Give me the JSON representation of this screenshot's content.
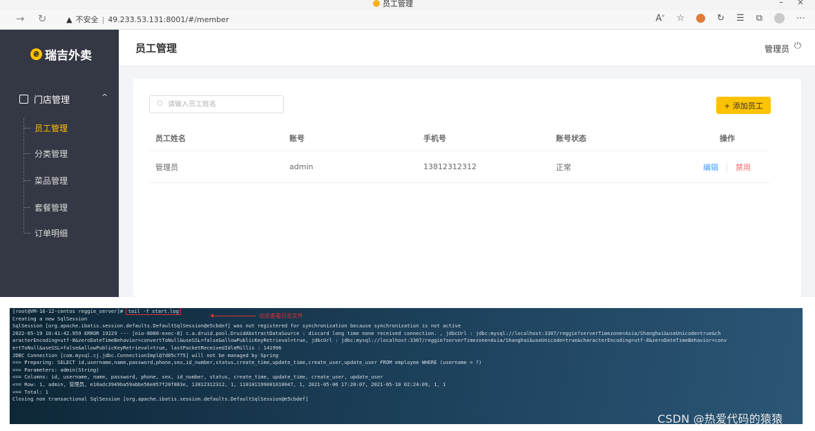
{
  "browser": {
    "tab_title": "员工管理",
    "security_label": "不安全",
    "url": "49.233.53.131:8001/#/member"
  },
  "app": {
    "logo_text": "瑞吉外卖",
    "page_title": "员工管理",
    "user_name": "管理员",
    "sidebar": {
      "group_label": "门店管理",
      "items": [
        {
          "label": "员工管理",
          "active": true
        },
        {
          "label": "分类管理",
          "active": false
        },
        {
          "label": "菜品管理",
          "active": false
        },
        {
          "label": "套餐管理",
          "active": false
        },
        {
          "label": "订单明细",
          "active": false
        }
      ]
    },
    "search": {
      "placeholder": "请输入员工姓名",
      "value": ""
    },
    "add_button_label": "+ 添加员工",
    "table": {
      "headers": [
        "员工姓名",
        "账号",
        "手机号",
        "账号状态",
        "操作"
      ],
      "rows": [
        {
          "name": "管理员",
          "account": "admin",
          "phone": "13812312312",
          "status": "正常",
          "edit": "编辑",
          "disable": "禁用"
        }
      ]
    },
    "colors": {
      "sidebar_bg": "#343744",
      "accent": "#ffc200",
      "edit": "#419eff",
      "disable": "#f56c6c"
    }
  },
  "terminal": {
    "prompt": "[root@VM-16-12-centos reggie_server]#",
    "command": "tail -f start.log",
    "annotation": "动态查看日志文件",
    "lines": [
      "Creating a new SqlSession",
      "SqlSession [org.apache.ibatis.session.defaults.DefaultSqlSession@e5cbdef] was not registered for synchronization because synchronization is not active",
      "2022-05-19 10:41:42.959 ERROR 19229 --- [nio-8080-exec-8] c.a.druid.pool.DruidAbstractDataSource   : discard long time none received connection. , jdbcUrl : jdbc:mysql://localhost:3307/reggie?serverTimezone=Asia/Shanghai&useUnicode=true&ch",
      "aracterEncoding=utf-8&zeroDateTimeBehavior=convertToNull&useSSL=false&allowPublicKeyRetrieval=true, jdbcUrl : jdbc:mysql://localhost:3307/reggie?serverTimezone=Asia/Shanghai&useUnicode=true&characterEncoding=utf-8&zeroDateTimeBehavior=conv",
      "ertToNull&useSSL=false&allowPublicKeyRetrieval=true, lastPacketReceivedIdleMillis : 141996",
      "JDBC Connection [com.mysql.cj.jdbc.ConnectionImpl@7d85c775] will not be managed by Spring",
      "==>  Preparing: SELECT id,username,name,password,phone,sex,id_number,status,create_time,update_time,create_user,update_user FROM employee WHERE (username = ?)",
      "==> Parameters: admin(String)",
      "<==    Columns: id, username, name, password, phone, sex, id_number, status, create_time, update_time, create_user, update_user",
      "<==        Row: 1, admin, 管理员, e10adc3949ba59abbe56e057f20f883e, 13812312312, 1, 110101199001010047, 1, 2021-05-06 17:20:07, 2021-05-10 02:24:09, 1, 1",
      "<==      Total: 1",
      "Closing non transactional SqlSession [org.apache.ibatis.session.defaults.DefaultSqlSession@e5cbdef]"
    ]
  },
  "watermark": "CSDN @热爱代码的猿猿"
}
